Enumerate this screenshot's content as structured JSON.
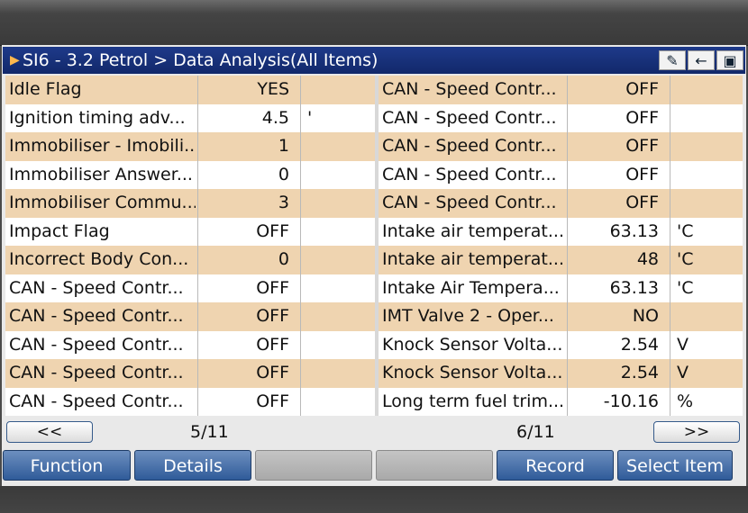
{
  "title": {
    "text": "SI6 - 3.2 Petrol > Data Analysis(All Items)",
    "icons": [
      "pencil-icon",
      "back-arrow-icon",
      "camera-icon"
    ]
  },
  "left_rows": [
    {
      "name": "Idle Flag",
      "value": "YES",
      "unit": ""
    },
    {
      "name": "Ignition timing adv...",
      "value": "4.5",
      "unit": "'"
    },
    {
      "name": "Immobiliser - Imobili...",
      "value": "1",
      "unit": ""
    },
    {
      "name": "Immobiliser Answer...",
      "value": "0",
      "unit": ""
    },
    {
      "name": "Immobiliser Commu...",
      "value": "3",
      "unit": ""
    },
    {
      "name": "Impact Flag",
      "value": "OFF",
      "unit": ""
    },
    {
      "name": "Incorrect Body Con...",
      "value": "0",
      "unit": ""
    },
    {
      "name": "CAN - Speed Contr...",
      "value": "OFF",
      "unit": ""
    },
    {
      "name": "CAN - Speed Contr...",
      "value": "OFF",
      "unit": ""
    },
    {
      "name": "CAN - Speed Contr...",
      "value": "OFF",
      "unit": ""
    },
    {
      "name": "CAN - Speed Contr...",
      "value": "OFF",
      "unit": ""
    },
    {
      "name": "CAN - Speed Contr...",
      "value": "OFF",
      "unit": ""
    }
  ],
  "right_rows": [
    {
      "name": "CAN - Speed Contr...",
      "value": "OFF",
      "unit": ""
    },
    {
      "name": "CAN - Speed Contr...",
      "value": "OFF",
      "unit": ""
    },
    {
      "name": "CAN - Speed Contr...",
      "value": "OFF",
      "unit": ""
    },
    {
      "name": "CAN - Speed Contr...",
      "value": "OFF",
      "unit": ""
    },
    {
      "name": "CAN - Speed Contr...",
      "value": "OFF",
      "unit": ""
    },
    {
      "name": "Intake air temperat...",
      "value": "63.13",
      "unit": "'C"
    },
    {
      "name": "Intake air temperat...",
      "value": "48",
      "unit": "'C"
    },
    {
      "name": "Intake Air Tempera...",
      "value": "63.13",
      "unit": "'C"
    },
    {
      "name": "IMT Valve 2 - Oper...",
      "value": "NO",
      "unit": ""
    },
    {
      "name": "Knock Sensor Volta...",
      "value": "2.54",
      "unit": "V"
    },
    {
      "name": "Knock Sensor Volta...",
      "value": "2.54",
      "unit": "V"
    },
    {
      "name": "Long term fuel trim...",
      "value": "-10.16",
      "unit": "%"
    }
  ],
  "pager": {
    "prev_label": "<<",
    "next_label": ">>",
    "left_page": "5/11",
    "right_page": "6/11"
  },
  "buttons": {
    "function": "Function",
    "details": "Details",
    "blank1": "",
    "blank2": "",
    "record": "Record",
    "select_item": "Select Item"
  },
  "colors": {
    "title_bg": "#1e3a8a",
    "row_alt": "#efd4b0",
    "row_plain": "#ffffff",
    "button": "#2f5b99"
  }
}
